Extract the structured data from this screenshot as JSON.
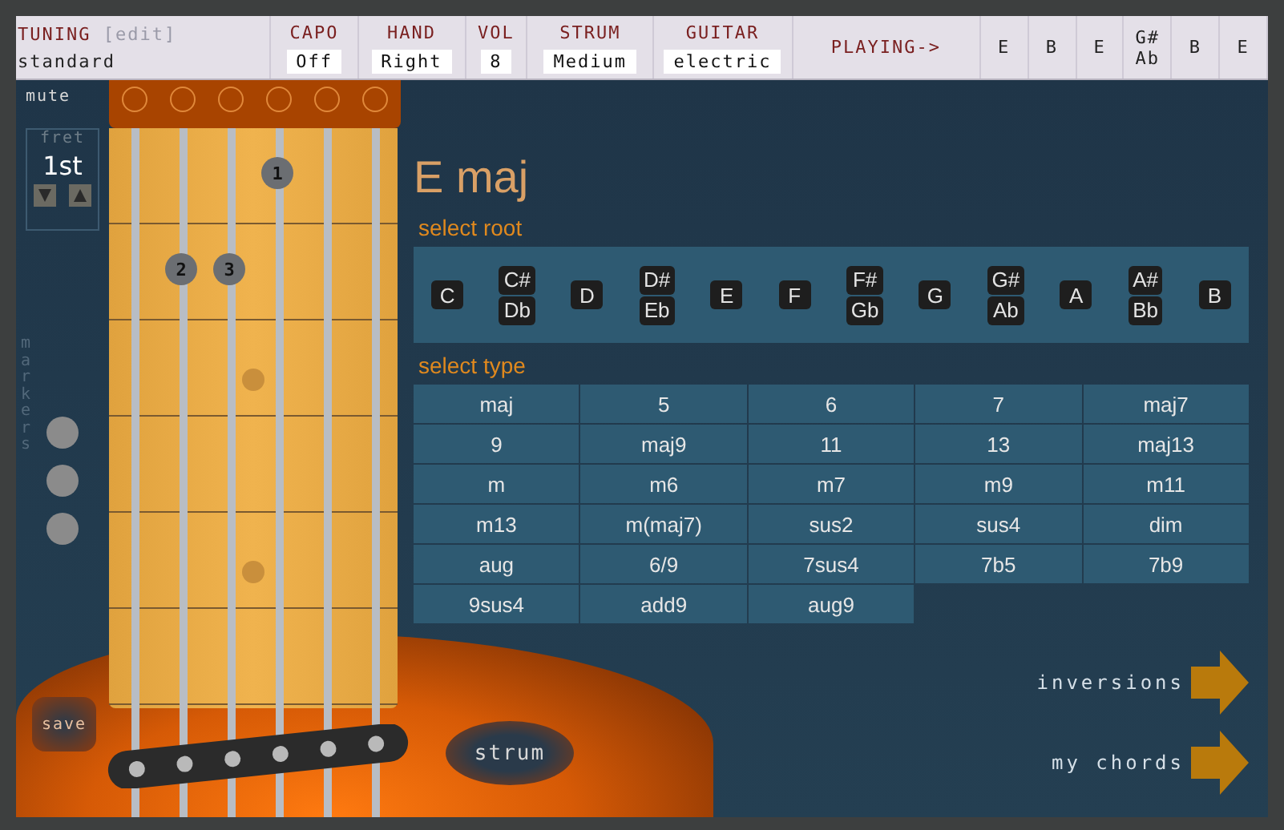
{
  "header": {
    "tuning": {
      "label": "TUNING",
      "edit": "[edit]",
      "value": "standard"
    },
    "settings": [
      {
        "label": "CAPO",
        "value": "Off"
      },
      {
        "label": "HAND",
        "value": "Right"
      },
      {
        "label": "VOL",
        "value": "8"
      },
      {
        "label": "STRUM",
        "value": "Medium"
      },
      {
        "label": "GUITAR",
        "value": "electric"
      }
    ],
    "playing_label": "PLAYING->",
    "playing": [
      [
        "E"
      ],
      [
        "B"
      ],
      [
        "E"
      ],
      [
        "G#",
        "Ab"
      ],
      [
        "B"
      ],
      [
        "E"
      ]
    ]
  },
  "neck": {
    "mute_label": "mute",
    "strings": [
      {
        "muted": false
      },
      {
        "muted": false
      },
      {
        "muted": false
      },
      {
        "muted": false
      },
      {
        "muted": false
      },
      {
        "muted": false
      }
    ],
    "fret": {
      "label": "fret",
      "value": "1st"
    },
    "markers_label": "markers",
    "fret_rows": [
      [
        null,
        null,
        null,
        "1",
        null,
        null
      ],
      [
        null,
        "2",
        "3",
        null,
        null,
        null
      ],
      [
        null,
        null,
        null,
        null,
        null,
        null
      ],
      [
        null,
        null,
        null,
        null,
        null,
        null
      ],
      [
        null,
        null,
        null,
        null,
        null,
        null
      ],
      [
        null,
        null,
        null,
        null,
        null,
        null
      ]
    ],
    "save": "save",
    "strum": "strum"
  },
  "chord": {
    "name": "E maj",
    "root_label": "select root",
    "roots": [
      [
        "C"
      ],
      [
        "C#",
        "Db"
      ],
      [
        "D"
      ],
      [
        "D#",
        "Eb"
      ],
      [
        "E"
      ],
      [
        "F"
      ],
      [
        "F#",
        "Gb"
      ],
      [
        "G"
      ],
      [
        "G#",
        "Ab"
      ],
      [
        "A"
      ],
      [
        "A#",
        "Bb"
      ],
      [
        "B"
      ]
    ],
    "type_label": "select type",
    "types": [
      "maj",
      "5",
      "6",
      "7",
      "maj7",
      "9",
      "maj9",
      "11",
      "13",
      "maj13",
      "m",
      "m6",
      "m7",
      "m9",
      "m11",
      "m13",
      "m(maj7)",
      "sus2",
      "sus4",
      "dim",
      "aug",
      "6/9",
      "7sus4",
      "7b5",
      "7b9",
      "9sus4",
      "add9",
      "aug9"
    ]
  },
  "links": [
    "inversions",
    "my chords"
  ]
}
